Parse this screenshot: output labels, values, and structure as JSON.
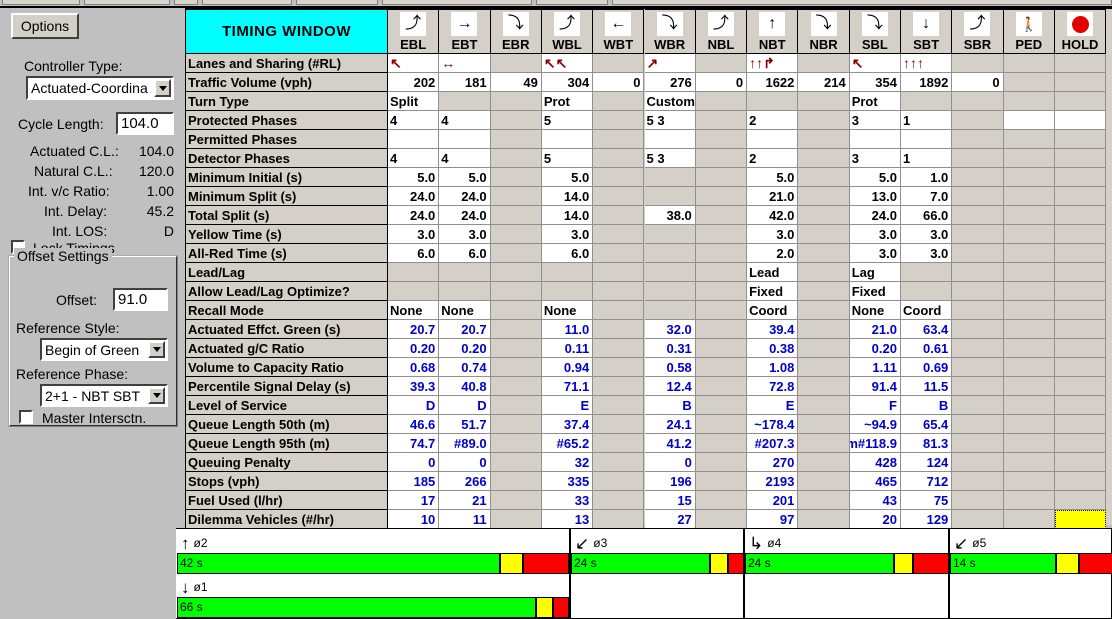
{
  "window": {
    "title": "TIMING WINDOW"
  },
  "sidebar": {
    "options_label": "Options",
    "controller_type_label": "Controller Type:",
    "controller_type_value": "Actuated-Coordina",
    "cycle_length_label": "Cycle Length:",
    "cycle_length_value": "104.0",
    "actuated_cl_label": "Actuated C.L.:",
    "actuated_cl_value": "104.0",
    "natural_cl_label": "Natural C.L.:",
    "natural_cl_value": "120.0",
    "int_vc_label": "Int. v/c Ratio:",
    "int_vc_value": "1.00",
    "int_delay_label": "Int. Delay:",
    "int_delay_value": "45.2",
    "int_los_label": "Int. LOS:",
    "int_los_value": "D",
    "lock_timings_label": "Lock Timings",
    "lock_timings_checked": false,
    "offset_group_title": "Offset Settings",
    "offset_label": "Offset:",
    "offset_value": "91.0",
    "reference_style_label": "Reference Style:",
    "reference_style_value": "Begin of Green",
    "reference_phase_label": "Reference Phase:",
    "reference_phase_value": "2+1 - NBT SBT",
    "master_intersection_label": "Master Intersctn.",
    "master_intersection_checked": false
  },
  "table": {
    "columns": [
      {
        "name": "EBL",
        "icon": "arrow-left-turn-icon",
        "glyph": "⤴"
      },
      {
        "name": "EBT",
        "icon": "arrow-through-icon",
        "glyph": "→"
      },
      {
        "name": "EBR",
        "icon": "arrow-right-turn-icon",
        "glyph": "⤵"
      },
      {
        "name": "WBL",
        "icon": "arrow-left-turn-icon",
        "glyph": "⤴"
      },
      {
        "name": "WBT",
        "icon": "arrow-through-icon",
        "glyph": "←"
      },
      {
        "name": "WBR",
        "icon": "arrow-right-turn-icon",
        "glyph": "⤵"
      },
      {
        "name": "NBL",
        "icon": "arrow-left-turn-icon",
        "glyph": "⤴"
      },
      {
        "name": "NBT",
        "icon": "arrow-through-icon",
        "glyph": "↑"
      },
      {
        "name": "NBR",
        "icon": "arrow-right-turn-icon",
        "glyph": "⤵"
      },
      {
        "name": "SBL",
        "icon": "arrow-left-turn-icon",
        "glyph": "⤵"
      },
      {
        "name": "SBT",
        "icon": "arrow-through-icon",
        "glyph": "↓"
      },
      {
        "name": "SBR",
        "icon": "arrow-right-turn-icon",
        "glyph": "⤴"
      },
      {
        "name": "PED",
        "icon": "pedestrian-icon",
        "glyph": "Ὣ6"
      },
      {
        "name": "HOLD",
        "icon": "hold-red-circle-icon",
        "glyph": "●"
      }
    ],
    "rows": [
      {
        "label": "Lanes and Sharing (#RL)",
        "style": "lanes",
        "cells": [
          "↖",
          "↔",
          "",
          "↖↖",
          "",
          "↗",
          "",
          "↑↑↱",
          "",
          "↖",
          "↑↑↑",
          "",
          null,
          null
        ]
      },
      {
        "label": "Traffic Volume (vph)",
        "style": "num",
        "cells": [
          "202",
          "181",
          "49",
          "304",
          "0",
          "276",
          "0",
          "1622",
          "214",
          "354",
          "1892",
          "0",
          null,
          null
        ]
      },
      {
        "label": "Turn Type",
        "style": "txt",
        "cells": [
          "Split",
          "",
          "",
          "Prot",
          "",
          "Custom",
          "",
          "",
          "",
          "Prot",
          "",
          "",
          null,
          null
        ]
      },
      {
        "label": "Protected Phases",
        "style": "txt",
        "cells": [
          "4",
          "4",
          "",
          "5",
          "",
          "5 3",
          "",
          "2",
          "",
          "3",
          "1",
          "",
          null,
          null
        ]
      },
      {
        "label": "Permitted Phases",
        "style": "txt",
        "cells": [
          "",
          "",
          "",
          "",
          "",
          "",
          "",
          "",
          "",
          "",
          "",
          "",
          null,
          null
        ]
      },
      {
        "label": "Detector Phases",
        "style": "txt",
        "cells": [
          "4",
          "4",
          "",
          "5",
          "",
          "5 3",
          "",
          "2",
          "",
          "3",
          "1",
          "",
          null,
          null
        ]
      },
      {
        "label": "Minimum Initial (s)",
        "style": "num",
        "cells": [
          "5.0",
          "5.0",
          "",
          "5.0",
          "",
          "",
          "",
          "5.0",
          "",
          "5.0",
          "1.0",
          "",
          null,
          null
        ]
      },
      {
        "label": "Minimum Split (s)",
        "style": "num",
        "cells": [
          "24.0",
          "24.0",
          "",
          "14.0",
          "",
          "",
          "",
          "21.0",
          "",
          "13.0",
          "7.0",
          "",
          null,
          null
        ]
      },
      {
        "label": "Total Split (s)",
        "style": "num",
        "cells": [
          "24.0",
          "24.0",
          "",
          "14.0",
          "",
          "38.0",
          "",
          "42.0",
          "",
          "24.0",
          "66.0",
          "",
          null,
          null
        ]
      },
      {
        "label": "Yellow Time (s)",
        "style": "num",
        "cells": [
          "3.0",
          "3.0",
          "",
          "3.0",
          "",
          "",
          "",
          "3.0",
          "",
          "3.0",
          "3.0",
          "",
          null,
          null
        ]
      },
      {
        "label": "All-Red Time (s)",
        "style": "num",
        "cells": [
          "6.0",
          "6.0",
          "",
          "6.0",
          "",
          "",
          "",
          "2.0",
          "",
          "3.0",
          "3.0",
          "",
          null,
          null
        ]
      },
      {
        "label": "Lead/Lag",
        "style": "txt",
        "cells": [
          "",
          "",
          "",
          "",
          "",
          "",
          "",
          "Lead",
          "",
          "Lag",
          "",
          "",
          null,
          null
        ]
      },
      {
        "label": "Allow Lead/Lag Optimize?",
        "style": "txt",
        "cells": [
          "",
          "",
          "",
          "",
          "",
          "",
          "",
          "Fixed",
          "",
          "Fixed",
          "",
          "",
          null,
          null
        ]
      },
      {
        "label": "Recall Mode",
        "style": "txt",
        "cells": [
          "None",
          "None",
          "",
          "None",
          "",
          "",
          "",
          "Coord",
          "",
          "None",
          "Coord",
          "",
          null,
          null
        ]
      },
      {
        "label": "Actuated Effct. Green (s)",
        "style": "num blue",
        "cells": [
          "20.7",
          "20.7",
          "",
          "11.0",
          "",
          "32.0",
          "",
          "39.4",
          "",
          "21.0",
          "63.4",
          "",
          null,
          null
        ]
      },
      {
        "label": "Actuated g/C Ratio",
        "style": "num blue",
        "cells": [
          "0.20",
          "0.20",
          "",
          "0.11",
          "",
          "0.31",
          "",
          "0.38",
          "",
          "0.20",
          "0.61",
          "",
          null,
          null
        ]
      },
      {
        "label": "Volume to Capacity Ratio",
        "style": "num blue",
        "cells": [
          "0.68",
          "0.74",
          "",
          "0.94",
          "",
          "0.58",
          "",
          "1.08",
          "",
          "1.11",
          "0.69",
          "",
          null,
          null
        ]
      },
      {
        "label": "Percentile Signal Delay (s)",
        "style": "num blue",
        "cells": [
          "39.3",
          "40.8",
          "",
          "71.1",
          "",
          "12.4",
          "",
          "72.8",
          "",
          "91.4",
          "11.5",
          "",
          null,
          null
        ]
      },
      {
        "label": "Level of Service",
        "style": "num blue",
        "cells": [
          "D",
          "D",
          "",
          "E",
          "",
          "B",
          "",
          "E",
          "",
          "F",
          "B",
          "",
          null,
          null
        ]
      },
      {
        "label": "Queue Length 50th (m)",
        "style": "num blue",
        "cells": [
          "46.6",
          "51.7",
          "",
          "37.4",
          "",
          "24.1",
          "",
          "~178.4",
          "",
          "~94.9",
          "65.4",
          "",
          null,
          null
        ]
      },
      {
        "label": "Queue Length 95th (m)",
        "style": "num blue",
        "cells": [
          "74.7",
          "#89.0",
          "",
          "#65.2",
          "",
          "41.2",
          "",
          "#207.3",
          "",
          "m#118.9",
          "81.3",
          "",
          null,
          null
        ]
      },
      {
        "label": "Queuing Penalty",
        "style": "num blue",
        "cells": [
          "0",
          "0",
          "",
          "32",
          "",
          "0",
          "",
          "270",
          "",
          "428",
          "124",
          "",
          null,
          null
        ]
      },
      {
        "label": "Stops (vph)",
        "style": "num blue",
        "cells": [
          "185",
          "266",
          "",
          "335",
          "",
          "196",
          "",
          "2193",
          "",
          "465",
          "712",
          "",
          null,
          null
        ]
      },
      {
        "label": "Fuel Used (l/hr)",
        "style": "num blue",
        "cells": [
          "17",
          "21",
          "",
          "33",
          "",
          "15",
          "",
          "201",
          "",
          "43",
          "75",
          "",
          null,
          null
        ]
      },
      {
        "label": "Dilemma Vehicles (#/hr)",
        "style": "num blue",
        "cells": [
          "10",
          "11",
          "",
          "13",
          "",
          "27",
          "",
          "97",
          "",
          "20",
          "129",
          "",
          null,
          "HILITE"
        ]
      }
    ]
  },
  "phase_diagram": {
    "groups": [
      {
        "phase_top": "ø2",
        "arrow_top": "↑",
        "phase_bottom": "ø1",
        "arrow_bottom": "↓",
        "bar_top": {
          "label": "42 s",
          "green": 42,
          "yellow": 3,
          "red": 6
        },
        "bar_bottom": {
          "label": "66 s",
          "green": 66,
          "yellow": 3,
          "red": 3
        }
      },
      {
        "phase_top": "ø3",
        "arrow_top": "↙",
        "phase_bottom": "",
        "arrow_bottom": "",
        "bar_top": {
          "label": "24 s",
          "green": 24,
          "yellow": 3,
          "red": 3
        },
        "bar_bottom": null
      },
      {
        "phase_top": "ø4",
        "arrow_top": "↳",
        "phase_bottom": "",
        "arrow_bottom": "",
        "bar_top": {
          "label": "24 s",
          "green": 24,
          "yellow": 3,
          "red": 6
        },
        "bar_bottom": null
      },
      {
        "phase_top": "ø5",
        "arrow_top": "↙",
        "phase_bottom": "",
        "arrow_bottom": "",
        "bar_top": {
          "label": "14 s",
          "green": 14,
          "yellow": 3,
          "red": 6
        },
        "bar_bottom": null
      }
    ]
  },
  "colors": {
    "title_bg": "#00ffff",
    "panel_bg": "#c0c0c0",
    "cell_bg": "#d4d0c8",
    "computed_text": "#0000cc",
    "lane_arrow": "#8b0000",
    "green": "#00ff00",
    "yellow": "#ffff00",
    "red": "#ff0000",
    "highlight": "#ffff00"
  }
}
